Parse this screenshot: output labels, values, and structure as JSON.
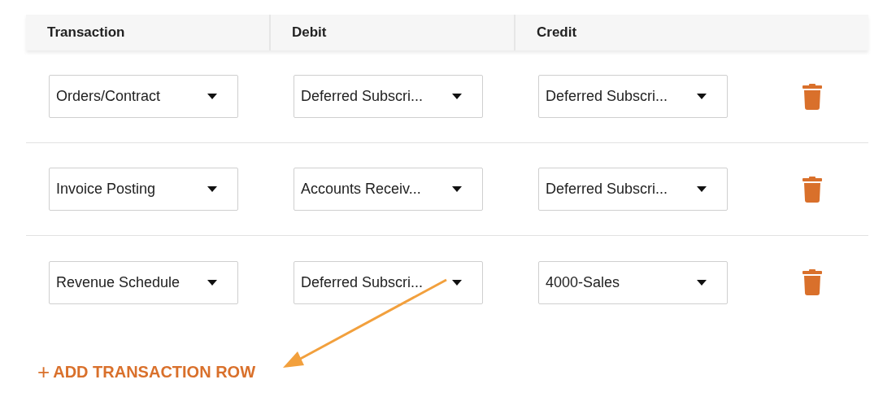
{
  "table": {
    "columns": [
      "Transaction",
      "Debit",
      "Credit"
    ],
    "rows": [
      {
        "transaction": "Orders/Contract",
        "debit": "Deferred Subscri...",
        "credit": "Deferred Subscri..."
      },
      {
        "transaction": "Invoice Posting",
        "debit": "Accounts Receiv...",
        "credit": "Deferred Subscri..."
      },
      {
        "transaction": "Revenue Schedule",
        "debit": "Deferred Subscri...",
        "credit": "4000-Sales"
      }
    ]
  },
  "add_button": {
    "icon": "+",
    "label": "ADD TRANSACTION ROW"
  }
}
